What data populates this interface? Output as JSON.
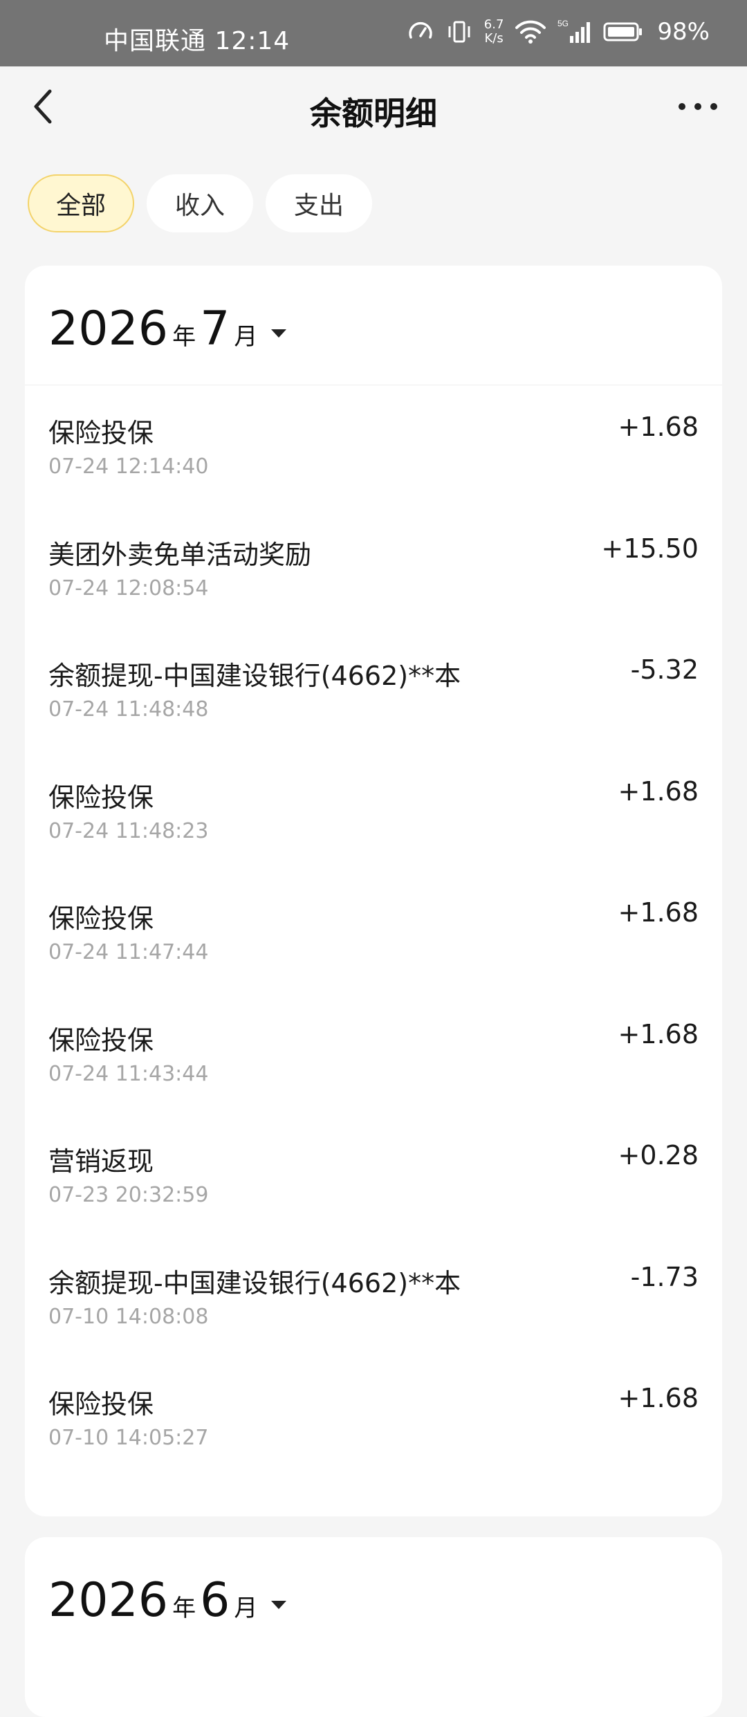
{
  "status_bar": {
    "carrier_time": "中国联通 12:14",
    "net_speed_value": "6.7",
    "net_speed_unit": "K/s",
    "network_type": "5G",
    "battery": "98%",
    "icons": [
      "speedometer-icon",
      "vibrate-icon",
      "wifi-icon",
      "signal-icon",
      "battery-icon"
    ]
  },
  "header": {
    "title": "余额明细"
  },
  "filters": {
    "tabs": [
      {
        "label": "全部",
        "active": true
      },
      {
        "label": "收入",
        "active": false
      },
      {
        "label": "支出",
        "active": false
      }
    ]
  },
  "months": [
    {
      "year": "2026",
      "year_suffix": "年",
      "month": "7",
      "month_suffix": "月",
      "items": [
        {
          "title": "保险投保",
          "time": "07-24 12:14:40",
          "amount": "+1.68"
        },
        {
          "title": "美团外卖免单活动奖励",
          "time": "07-24 12:08:54",
          "amount": "+15.50"
        },
        {
          "title": "余额提现-中国建设银行(4662)**本",
          "time": "07-24 11:48:48",
          "amount": "-5.32"
        },
        {
          "title": "保险投保",
          "time": "07-24 11:48:23",
          "amount": "+1.68"
        },
        {
          "title": "保险投保",
          "time": "07-24 11:47:44",
          "amount": "+1.68"
        },
        {
          "title": "保险投保",
          "time": "07-24 11:43:44",
          "amount": "+1.68"
        },
        {
          "title": "营销返现",
          "time": "07-23 20:32:59",
          "amount": "+0.28"
        },
        {
          "title": "余额提现-中国建设银行(4662)**本",
          "time": "07-10 14:08:08",
          "amount": "-1.73"
        },
        {
          "title": "保险投保",
          "time": "07-10 14:05:27",
          "amount": "+1.68"
        }
      ]
    },
    {
      "year": "2026",
      "year_suffix": "年",
      "month": "6",
      "month_suffix": "月",
      "items": []
    }
  ]
}
